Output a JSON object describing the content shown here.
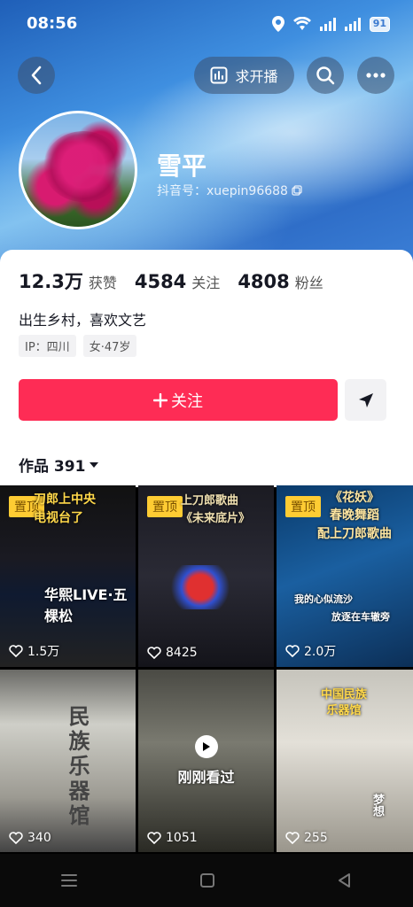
{
  "status_bar": {
    "time": "08:56",
    "battery": "91",
    "network_1": "5G",
    "network_2": "5G"
  },
  "header": {
    "live_label": "求开播"
  },
  "profile": {
    "nickname": "雪平",
    "douyin_id": "抖音号：xuepin96688",
    "stats": [
      {
        "value": "12.3万",
        "label": "获赞"
      },
      {
        "value": "4584",
        "label": "关注"
      },
      {
        "value": "4808",
        "label": "粉丝"
      }
    ],
    "bio": "出生乡村，喜欢文艺",
    "tags": [
      "IP：四川",
      "女·47岁"
    ],
    "follow_label": "关注"
  },
  "works": {
    "tab_label": "作品 391",
    "items": [
      {
        "pinned": "置顶",
        "likes": "1.5万",
        "overlay": "刀郎上中央\n电视台了",
        "banner": "华熙LIVE·五棵松"
      },
      {
        "pinned": "置顶",
        "likes": "8425",
        "overlay": "上刀郎歌曲\n《未来底片》"
      },
      {
        "pinned": "置顶",
        "likes": "2.0万",
        "overlay": "《花妖》\n春晚舞蹈\n配上刀郎歌曲",
        "lyric_1": "我的心似流沙",
        "lyric_2": "放逐在车辙旁"
      },
      {
        "likes": "340",
        "overlay": "民族乐器馆"
      },
      {
        "likes": "1051",
        "recently_watched": "刚刚看过"
      },
      {
        "likes": "255",
        "overlay": "中国民族\n乐器馆",
        "lyric_1": "梦想"
      }
    ]
  },
  "colors": {
    "accent": "#fe2c55",
    "pin": "#fecc33"
  }
}
